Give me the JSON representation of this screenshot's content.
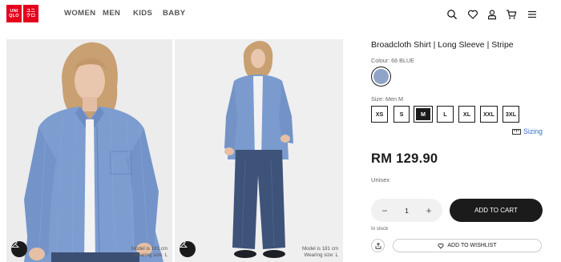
{
  "brand": {
    "logo_left": [
      "UNI",
      "QLO"
    ],
    "logo_right": [
      "ユニ",
      "クロ"
    ],
    "color": "#e5001c"
  },
  "nav": {
    "items": [
      "WOMEN",
      "MEN",
      "KIDS",
      "BABY"
    ]
  },
  "header_icons": [
    "search-icon",
    "heart-icon",
    "user-icon",
    "cart-icon",
    "menu-icon"
  ],
  "gallery": {
    "images": [
      {
        "note_line1": "Model is 181 cm",
        "note_line2": "Wearing size: L"
      },
      {
        "note_line1": "Model is 181 cm",
        "note_line2": "Wearing size: L"
      }
    ]
  },
  "product": {
    "title": "Broadcloth Shirt | Long Sleeve | Stripe",
    "color_label": "Colour: 66 BLUE",
    "swatch_color": "#8fa4c8",
    "size_label": "Size: Men M",
    "sizes": [
      "XS",
      "S",
      "M",
      "L",
      "XL",
      "XXL",
      "3XL"
    ],
    "selected_size": "M",
    "sizing_link": "Sizing",
    "price": "RM 129.90",
    "gender": "Unisex",
    "quantity": "1",
    "minus": "−",
    "plus": "+",
    "add_to_cart": "ADD TO CART",
    "stock": "In stock",
    "wishlist": "ADD TO WISHLIST"
  }
}
